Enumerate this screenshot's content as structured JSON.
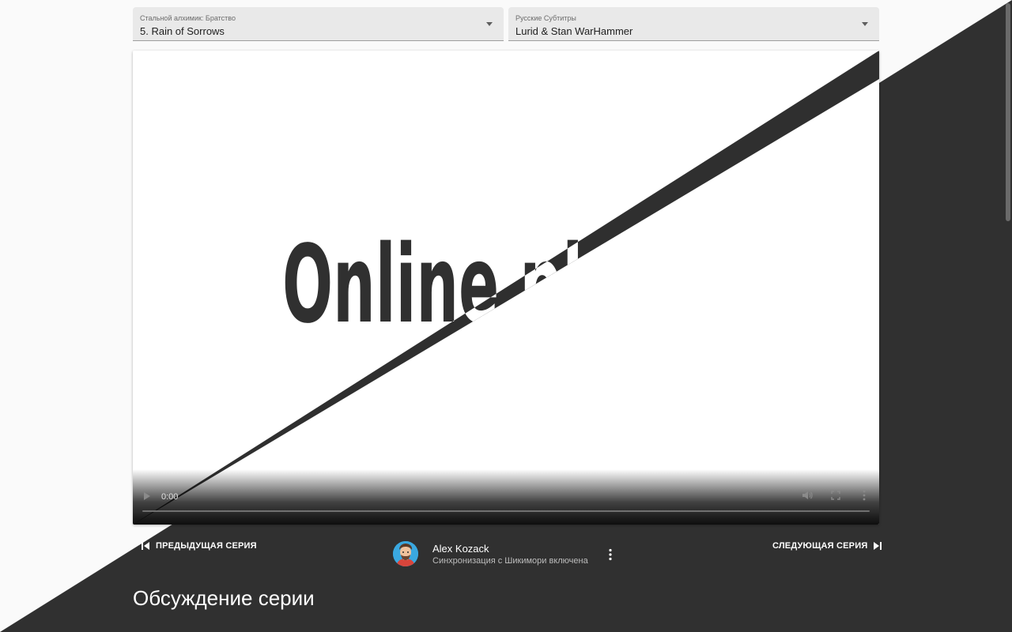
{
  "anime_select": {
    "label": "Стальной алхимик: Братство",
    "value": "5. Rain of Sorrows"
  },
  "subs_select": {
    "label": "Русские Субтитры",
    "value": "Lurid & Stan WarHammer"
  },
  "player": {
    "logo_text": "Online player",
    "time": "0:00"
  },
  "nav": {
    "prev_label": "ПРЕДЫДУЩАЯ СЕРИЯ",
    "next_label": "СЛЕДУЮЩАЯ СЕРИЯ"
  },
  "user": {
    "name": "Alex Kozack",
    "status": "Синхронизация с Шикимори включена"
  },
  "discussion": {
    "title": "Обсуждение серии"
  },
  "colors": {
    "dark_bg": "#303030",
    "light_bg": "#fafafa",
    "select_bg": "#e9e9e9"
  },
  "icons": [
    "dropdown-caret-icon",
    "play-icon",
    "volume-icon",
    "fullscreen-icon",
    "more-vert-icon",
    "skip-previous-icon",
    "skip-next-icon"
  ]
}
